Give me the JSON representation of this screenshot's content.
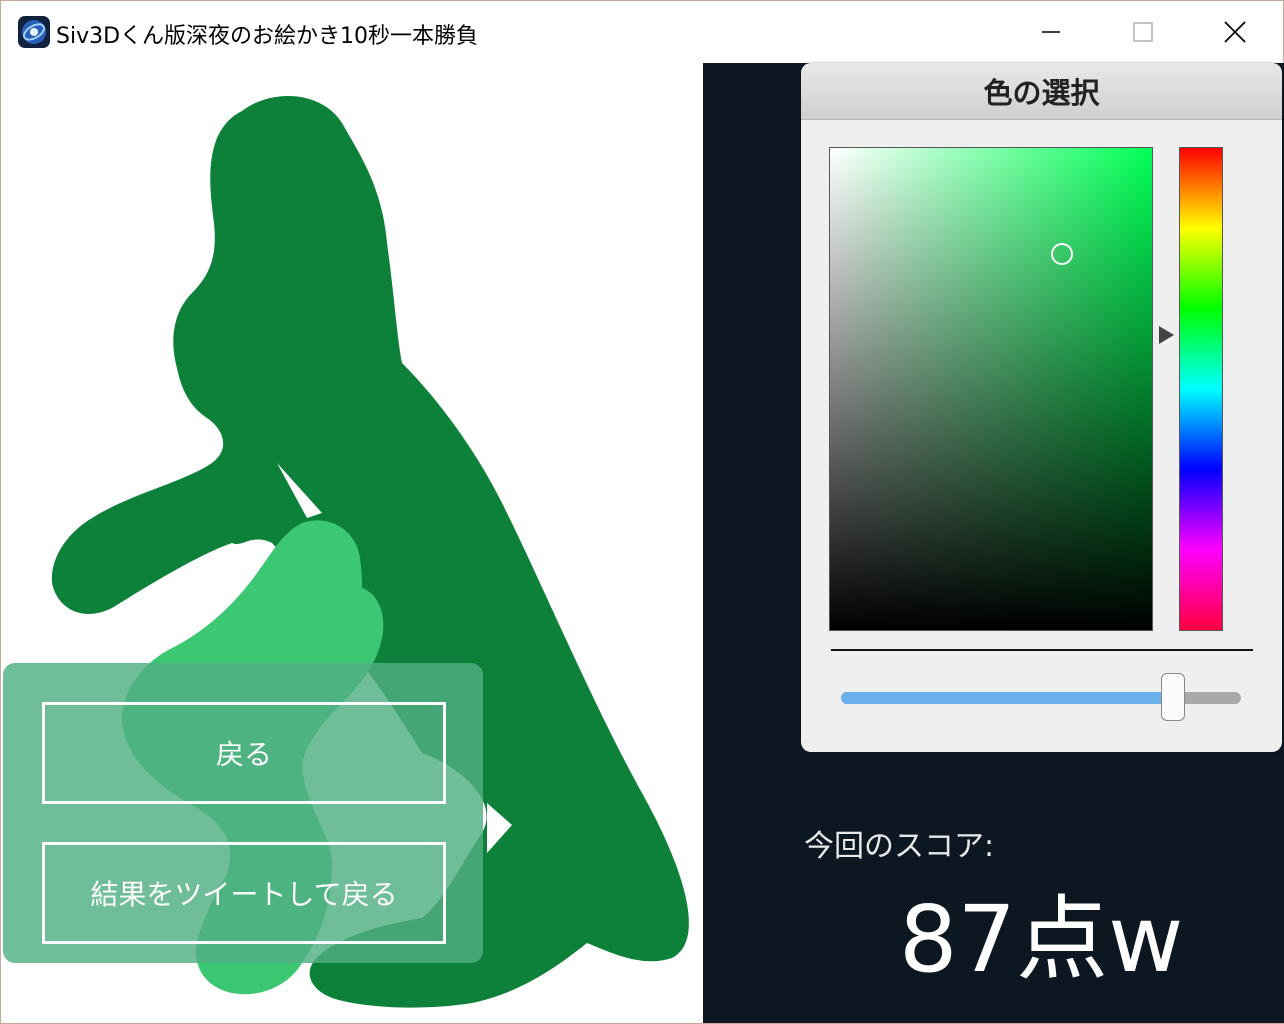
{
  "window": {
    "title": "Siv3Dくん版深夜のお絵かき10秒一本勝負",
    "controls": {
      "minimize": "minimize-icon",
      "maximize": "maximize-icon",
      "close": "close-icon"
    }
  },
  "canvas": {
    "drawing_colors": {
      "dark_green": "#0d8139",
      "light_green": "#3cc773"
    }
  },
  "color_picker": {
    "title": "色の選択",
    "selected_hue_color": "#00ff55",
    "cursor": {
      "saturation": 0.72,
      "value": 0.78
    },
    "hue_marker_position": 0.39,
    "alpha_value": 0.83
  },
  "score": {
    "label": "今回のスコア:",
    "value": "87点w"
  },
  "menu": {
    "back_label": "戻る",
    "tweet_back_label": "結果をツイートして戻る"
  }
}
